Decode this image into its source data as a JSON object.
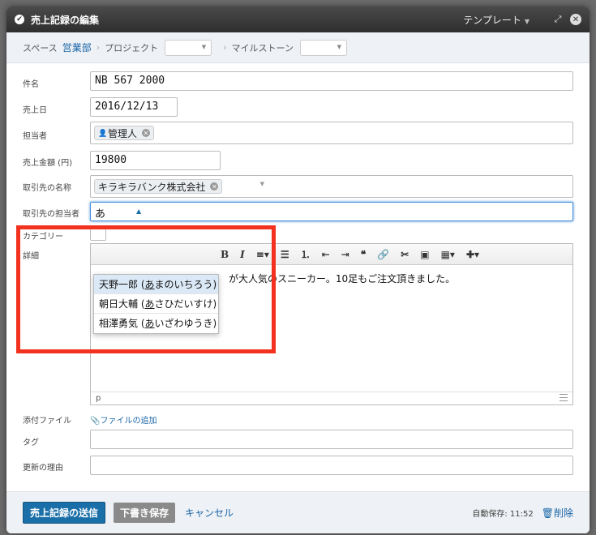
{
  "dialog": {
    "title": "売上記録の編集",
    "template_label": "テンプレート"
  },
  "breadcrumb": {
    "space_label": "スペース",
    "space_value": "営業部",
    "project_label": "プロジェクト",
    "milestone_label": "マイルストーン"
  },
  "fields": {
    "name_label": "件名",
    "name_value": "NB 567 2000",
    "date_label": "売上日",
    "date_value": "2016/12/13",
    "assignee_label": "担当者",
    "assignee_value": "管理人",
    "amount_label": "売上金額 (円)",
    "amount_value": "19800",
    "client_label": "取引先の名称",
    "client_value": "キラキラバンク株式会社",
    "contact_label": "取引先の担当者",
    "contact_value": "あ",
    "category_label": "カテゴリー",
    "detail_label": "詳細",
    "attach_label": "添付ファイル",
    "attach_link": "ファイルの追加",
    "tag_label": "タグ",
    "reason_label": "更新の理由"
  },
  "dropdown": {
    "options": [
      {
        "name": "天野一郎 (",
        "kana": "あ",
        "rest": "まのいちろう)"
      },
      {
        "name": "朝日大輔 (",
        "kana": "あ",
        "rest": "さひだいすけ)"
      },
      {
        "name": "相澤勇気 (",
        "kana": "あ",
        "rest": "いざわゆうき)"
      }
    ]
  },
  "editor": {
    "toolbar": {
      "bold": "B",
      "italic": "I"
    },
    "content": "が大人気のスニーカー。10足もご注文頂きました。",
    "status": "p"
  },
  "footer": {
    "submit": "売上記録の送信",
    "draft": "下書き保存",
    "cancel": "キャンセル",
    "autosave": "自動保存: 11:52",
    "delete": "削除"
  },
  "colors": {
    "accent": "#1b6fa8",
    "highlight": "#f2321f"
  }
}
